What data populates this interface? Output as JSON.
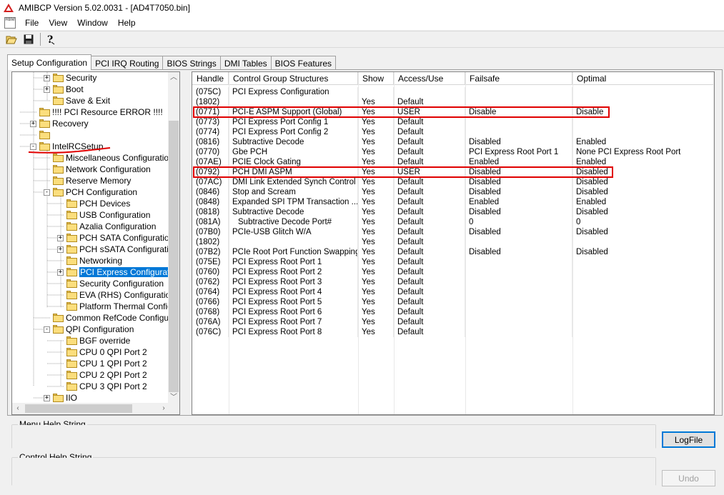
{
  "window": {
    "title": "AMIBCP Version 5.02.0031 - [AD4T7050.bin]"
  },
  "menubar": {
    "doc_icon_label": "RBM",
    "items": [
      "File",
      "View",
      "Window",
      "Help"
    ]
  },
  "toolbar": {
    "buttons": [
      "open-icon",
      "save-icon",
      "help-icon"
    ]
  },
  "tabs": [
    {
      "label": "Setup Configuration",
      "active": true
    },
    {
      "label": "PCI IRQ Routing",
      "active": false
    },
    {
      "label": "BIOS Strings",
      "active": false
    },
    {
      "label": "DMI Tables",
      "active": false
    },
    {
      "label": "BIOS Features",
      "active": false
    }
  ],
  "tree": {
    "nodes": [
      {
        "label": "Security",
        "level": 2,
        "expander": "+"
      },
      {
        "label": "Boot",
        "level": 2,
        "expander": "+"
      },
      {
        "label": "Save & Exit",
        "level": 2,
        "expander": ""
      },
      {
        "label": "!!!! PCI Resource ERROR !!!!",
        "level": 1,
        "expander": ""
      },
      {
        "label": "Recovery",
        "level": 1,
        "expander": "+"
      },
      {
        "label": "",
        "level": 1,
        "expander": ""
      },
      {
        "label": "IntelRCSetup",
        "level": 1,
        "expander": "-"
      },
      {
        "label": "Miscellaneous Configuration",
        "level": 2,
        "expander": ""
      },
      {
        "label": "Network Configuration",
        "level": 2,
        "expander": ""
      },
      {
        "label": "Reserve Memory",
        "level": 2,
        "expander": ""
      },
      {
        "label": "PCH Configuration",
        "level": 2,
        "expander": "-"
      },
      {
        "label": "PCH Devices",
        "level": 3,
        "expander": ""
      },
      {
        "label": "USB Configuration",
        "level": 3,
        "expander": ""
      },
      {
        "label": "Azalia Configuration",
        "level": 3,
        "expander": ""
      },
      {
        "label": "PCH SATA Configuration",
        "level": 3,
        "expander": "+"
      },
      {
        "label": "PCH sSATA Configuration",
        "level": 3,
        "expander": "+"
      },
      {
        "label": "Networking",
        "level": 3,
        "expander": ""
      },
      {
        "label": "PCI Express Configuration",
        "level": 3,
        "expander": "+",
        "selected": true
      },
      {
        "label": "Security Configuration",
        "level": 3,
        "expander": ""
      },
      {
        "label": "EVA (RHS) Configuration",
        "level": 3,
        "expander": ""
      },
      {
        "label": "Platform Thermal Configuration",
        "level": 3,
        "expander": ""
      },
      {
        "label": "Common RefCode Configuration",
        "level": 2,
        "expander": ""
      },
      {
        "label": "QPI Configuration",
        "level": 2,
        "expander": "-"
      },
      {
        "label": "BGF override",
        "level": 3,
        "expander": ""
      },
      {
        "label": "CPU 0 QPI Port 2",
        "level": 3,
        "expander": ""
      },
      {
        "label": "CPU 1 QPI Port 2",
        "level": 3,
        "expander": ""
      },
      {
        "label": "CPU 2 QPI Port 2",
        "level": 3,
        "expander": ""
      },
      {
        "label": "CPU 3 QPI Port 2",
        "level": 3,
        "expander": ""
      },
      {
        "label": "IIO",
        "level": 2,
        "expander": "+"
      }
    ]
  },
  "grid": {
    "columns": [
      "Handle",
      "Control Group Structures",
      "Show",
      "Access/Use",
      "Failsafe",
      "Optimal"
    ],
    "rows": [
      [
        "(075C)",
        "PCI Express Configuration",
        "",
        "",
        "",
        ""
      ],
      [
        "(1802)",
        "",
        "Yes",
        "Default",
        "",
        ""
      ],
      [
        "(0771)",
        "PCI-E ASPM Support (Global)",
        "Yes",
        "USER",
        "Disable",
        "Disable"
      ],
      [
        "(0773)",
        "PCI Express Port Config 1",
        "Yes",
        "Default",
        "",
        ""
      ],
      [
        "(0774)",
        "PCI Express Port Config 2",
        "Yes",
        "Default",
        "",
        ""
      ],
      [
        "(0816)",
        "Subtractive Decode",
        "Yes",
        "Default",
        "Disabled",
        "Enabled"
      ],
      [
        "(0770)",
        "Gbe PCH",
        "Yes",
        "Default",
        "PCI Express Root Port 1",
        "None PCI Express Root Port"
      ],
      [
        "(07AE)",
        "PCIE Clock Gating",
        "Yes",
        "Default",
        "Enabled",
        "Enabled"
      ],
      [
        "(0792)",
        "PCH DMI ASPM",
        "Yes",
        "USER",
        "Disabled",
        "Disabled"
      ],
      [
        "(07AC)",
        "DMI Link Extended Synch Control",
        "Yes",
        "Default",
        "Disabled",
        "Disabled"
      ],
      [
        "(0846)",
        "Stop and Scream",
        "Yes",
        "Default",
        "Disabled",
        "Disabled"
      ],
      [
        "(0848)",
        "Expanded SPI TPM Transaction ...",
        "Yes",
        "Default",
        "Enabled",
        "Enabled"
      ],
      [
        "(0818)",
        "Subtractive Decode",
        "Yes",
        "Default",
        "Disabled",
        "Disabled"
      ],
      [
        "(081A)",
        "Subtractive Decode Port#",
        "Yes",
        "Default",
        "0",
        "0"
      ],
      [
        "(07B0)",
        "PCIe-USB Glitch W/A",
        "Yes",
        "Default",
        "Disabled",
        "Disabled"
      ],
      [
        "(1802)",
        "",
        "Yes",
        "Default",
        "",
        ""
      ],
      [
        "(07B2)",
        "PCIe Root Port Function Swapping",
        "Yes",
        "Default",
        "Disabled",
        "Disabled"
      ],
      [
        "(075E)",
        "PCI Express Root Port 1",
        "Yes",
        "Default",
        "",
        ""
      ],
      [
        "(0760)",
        "PCI Express Root Port 2",
        "Yes",
        "Default",
        "",
        ""
      ],
      [
        "(0762)",
        "PCI Express Root Port 3",
        "Yes",
        "Default",
        "",
        ""
      ],
      [
        "(0764)",
        "PCI Express Root Port 4",
        "Yes",
        "Default",
        "",
        ""
      ],
      [
        "(0766)",
        "PCI Express Root Port 5",
        "Yes",
        "Default",
        "",
        ""
      ],
      [
        "(0768)",
        "PCI Express Root Port 6",
        "Yes",
        "Default",
        "",
        ""
      ],
      [
        "(076A)",
        "PCI Express Root Port 7",
        "Yes",
        "Default",
        "",
        ""
      ],
      [
        "(076C)",
        "PCI Express Root Port 8",
        "Yes",
        "Default",
        "",
        ""
      ]
    ],
    "highlighted_rows": [
      2,
      8
    ],
    "indented_rows": [
      13
    ]
  },
  "help": {
    "menu_label": "Menu Help String",
    "menu_text": "",
    "control_label": "Control Help String",
    "control_text": ""
  },
  "buttons": {
    "logfile": "LogFile",
    "undo": "Undo"
  },
  "colors": {
    "selection": "#0078d7",
    "highlight_box": "#e00000",
    "annotation_underline": "#e00000"
  }
}
